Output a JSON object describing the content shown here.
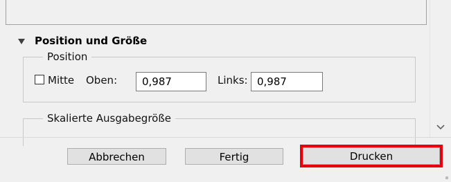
{
  "section": {
    "title": "Position und Größe",
    "expanded": true
  },
  "position_group": {
    "legend": "Position",
    "center_checkbox": {
      "label": "Mitte",
      "checked": false
    },
    "top": {
      "label": "Oben:",
      "value": "0,987"
    },
    "left": {
      "label": "Links:",
      "value": "0,987"
    }
  },
  "scaled_group": {
    "legend": "Skalierte Ausgabegröße"
  },
  "buttons": {
    "cancel": "Abbrechen",
    "done": "Fertig",
    "print": "Drucken"
  },
  "highlight_color": "#e8000b",
  "icons": {
    "collapse": "triangle-down-icon",
    "scroll_down": "chevron-down-icon"
  }
}
